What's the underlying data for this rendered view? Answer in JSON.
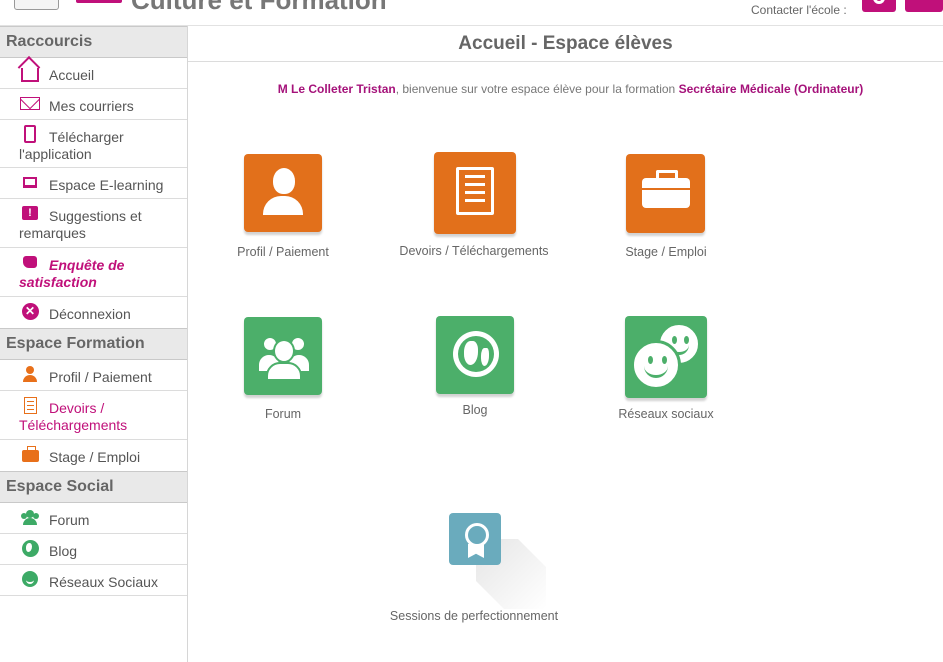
{
  "header": {
    "site_title": "Culture et Formation",
    "contact_label": "Contacter l'école :"
  },
  "sidebar": {
    "sections": [
      {
        "title": "Raccourcis",
        "items": [
          {
            "label": "Accueil",
            "icon": "home-icon"
          },
          {
            "label": "Mes courriers",
            "icon": "envelope-icon"
          },
          {
            "label": "Télécharger l'application",
            "icon": "mobile-phone-icon"
          },
          {
            "label": "Espace E-learning",
            "icon": "monitor-icon"
          },
          {
            "label": "Suggestions et remarques",
            "icon": "comment-exclamation-icon"
          },
          {
            "label": "Enquête de satisfaction",
            "icon": "thumbs-up-icon"
          },
          {
            "label": "Déconnexion",
            "icon": "close-circle-icon"
          }
        ]
      },
      {
        "title": "Espace Formation",
        "items": [
          {
            "label": "Profil / Paiement",
            "icon": "user-icon"
          },
          {
            "label": "Devoirs / Téléchargements",
            "icon": "document-list-icon"
          },
          {
            "label": "Stage / Emploi",
            "icon": "briefcase-icon"
          }
        ]
      },
      {
        "title": "Espace Social",
        "items": [
          {
            "label": "Forum",
            "icon": "users-icon"
          },
          {
            "label": "Blog",
            "icon": "globe-icon"
          },
          {
            "label": "Réseaux Sociaux",
            "icon": "smiley-icon"
          }
        ]
      }
    ]
  },
  "main": {
    "title": "Accueil - Espace élèves",
    "welcome": {
      "name": "M Le Colleter Tristan",
      "middle": ", bienvenue sur votre espace élève pour la formation ",
      "course": "Secrétaire Médicale (Ordinateur)"
    },
    "tiles": [
      {
        "label": "Profil / Paiement",
        "icon": "user-icon",
        "color": "#e2701b"
      },
      {
        "label": "Devoirs / Téléchargements",
        "icon": "document-list-icon",
        "color": "#e2701b"
      },
      {
        "label": "Stage / Emploi",
        "icon": "briefcase-icon",
        "color": "#e2701b"
      },
      {
        "label": "Forum",
        "icon": "users-icon",
        "color": "#4caf6a"
      },
      {
        "label": "Blog",
        "icon": "globe-icon",
        "color": "#4caf6a"
      },
      {
        "label": "Réseaux sociaux",
        "icon": "smiley-faces-icon",
        "color": "#4caf6a"
      },
      {
        "label": "Sessions de perfectionnement",
        "icon": "award-ribbon-icon",
        "color": "#6aabbd"
      }
    ]
  },
  "colors": {
    "brand_pink": "#c0107a",
    "orange": "#e2701b",
    "green": "#4caf6a",
    "teal": "#6aabbd"
  }
}
